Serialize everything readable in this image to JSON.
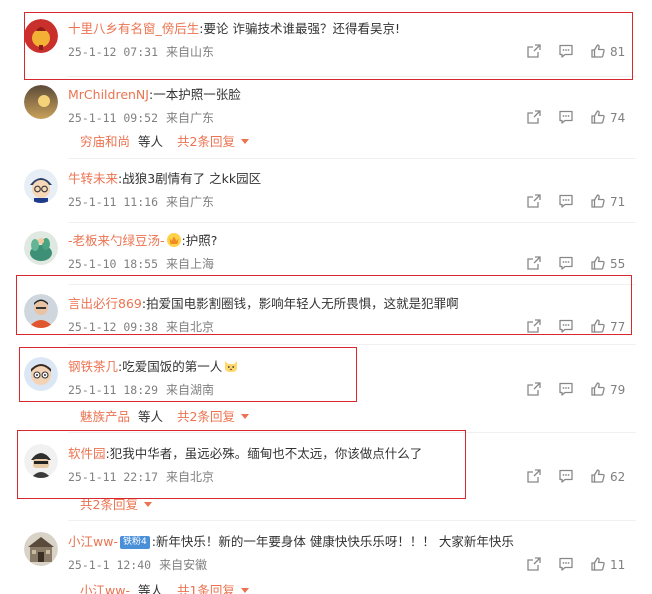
{
  "comments": [
    {
      "username": "十里八乡有名窗_傍后生",
      "text": ":要论 诈骗技术谁最强？还得看吴京!",
      "date": "25-1-12 07:31",
      "location": "来自山东",
      "likes": "81",
      "avatar_icon": "red-lantern-avatar-icon"
    },
    {
      "username": "MrChildrenNJ",
      "text": ":一本护照一张脸",
      "date": "25-1-11 09:52",
      "location": "来自广东",
      "likes": "74",
      "avatar_icon": "sunset-avatar-icon",
      "sub": {
        "name": "穷庙和尚",
        "deng": "等人",
        "more": "共2条回复"
      }
    },
    {
      "username": "牛转未来",
      "text": ":战狼3剧情有了 之kk园区",
      "date": "25-1-11 11:16",
      "location": "来自广东",
      "likes": "71",
      "avatar_icon": "cartoon-boy-avatar-icon"
    },
    {
      "username": "-老板来勺绿豆汤-",
      "text": ":护照?",
      "date": "25-1-10 18:55",
      "location": "来自上海",
      "likes": "55",
      "avatar_icon": "green-plant-avatar-icon"
    },
    {
      "username": "言出必行869",
      "text": ":拍爱国电影割圈钱，影响年轻人无所畏惧，这就是犯罪啊",
      "date": "25-1-12 09:38",
      "location": "来自北京",
      "likes": "77",
      "avatar_icon": "person-photo-avatar-icon"
    },
    {
      "username": "钢铁茶几",
      "text": ":吃爱国饭的第一人",
      "date": "25-1-11 18:29",
      "location": "来自湖南",
      "likes": "79",
      "avatar_icon": "cartoon-glasses-avatar-icon",
      "sub": {
        "name": "魅族产品",
        "deng": "等人",
        "more": "共2条回复"
      }
    },
    {
      "username": "软件园",
      "text": ":犯我中华者，虽远必殊。缅甸也不太远，你该做点什么了",
      "date": "25-1-11 22:17",
      "location": "来自北京",
      "likes": "62",
      "avatar_icon": "helmet-figure-avatar-icon",
      "sub": {
        "more": "共2条回复"
      }
    },
    {
      "username": "小江ww-",
      "badge": "铁粉4",
      "text": ":新年快乐！新的一年要身体 健康快快乐乐呀！！！ 大家新年快乐",
      "date": "25-1-1 12:40",
      "location": "来自安徽",
      "likes": "11",
      "avatar_icon": "building-photo-avatar-icon",
      "sub": {
        "name": "小江ww-",
        "deng": "等人",
        "more": "共1条回复"
      }
    }
  ],
  "icons": {
    "share": "share-icon",
    "reply": "comment-icon",
    "like": "thumbs-up-icon"
  },
  "colors": {
    "username": "#eb7350",
    "meta": "#808080",
    "highlight": "#d8282d"
  }
}
